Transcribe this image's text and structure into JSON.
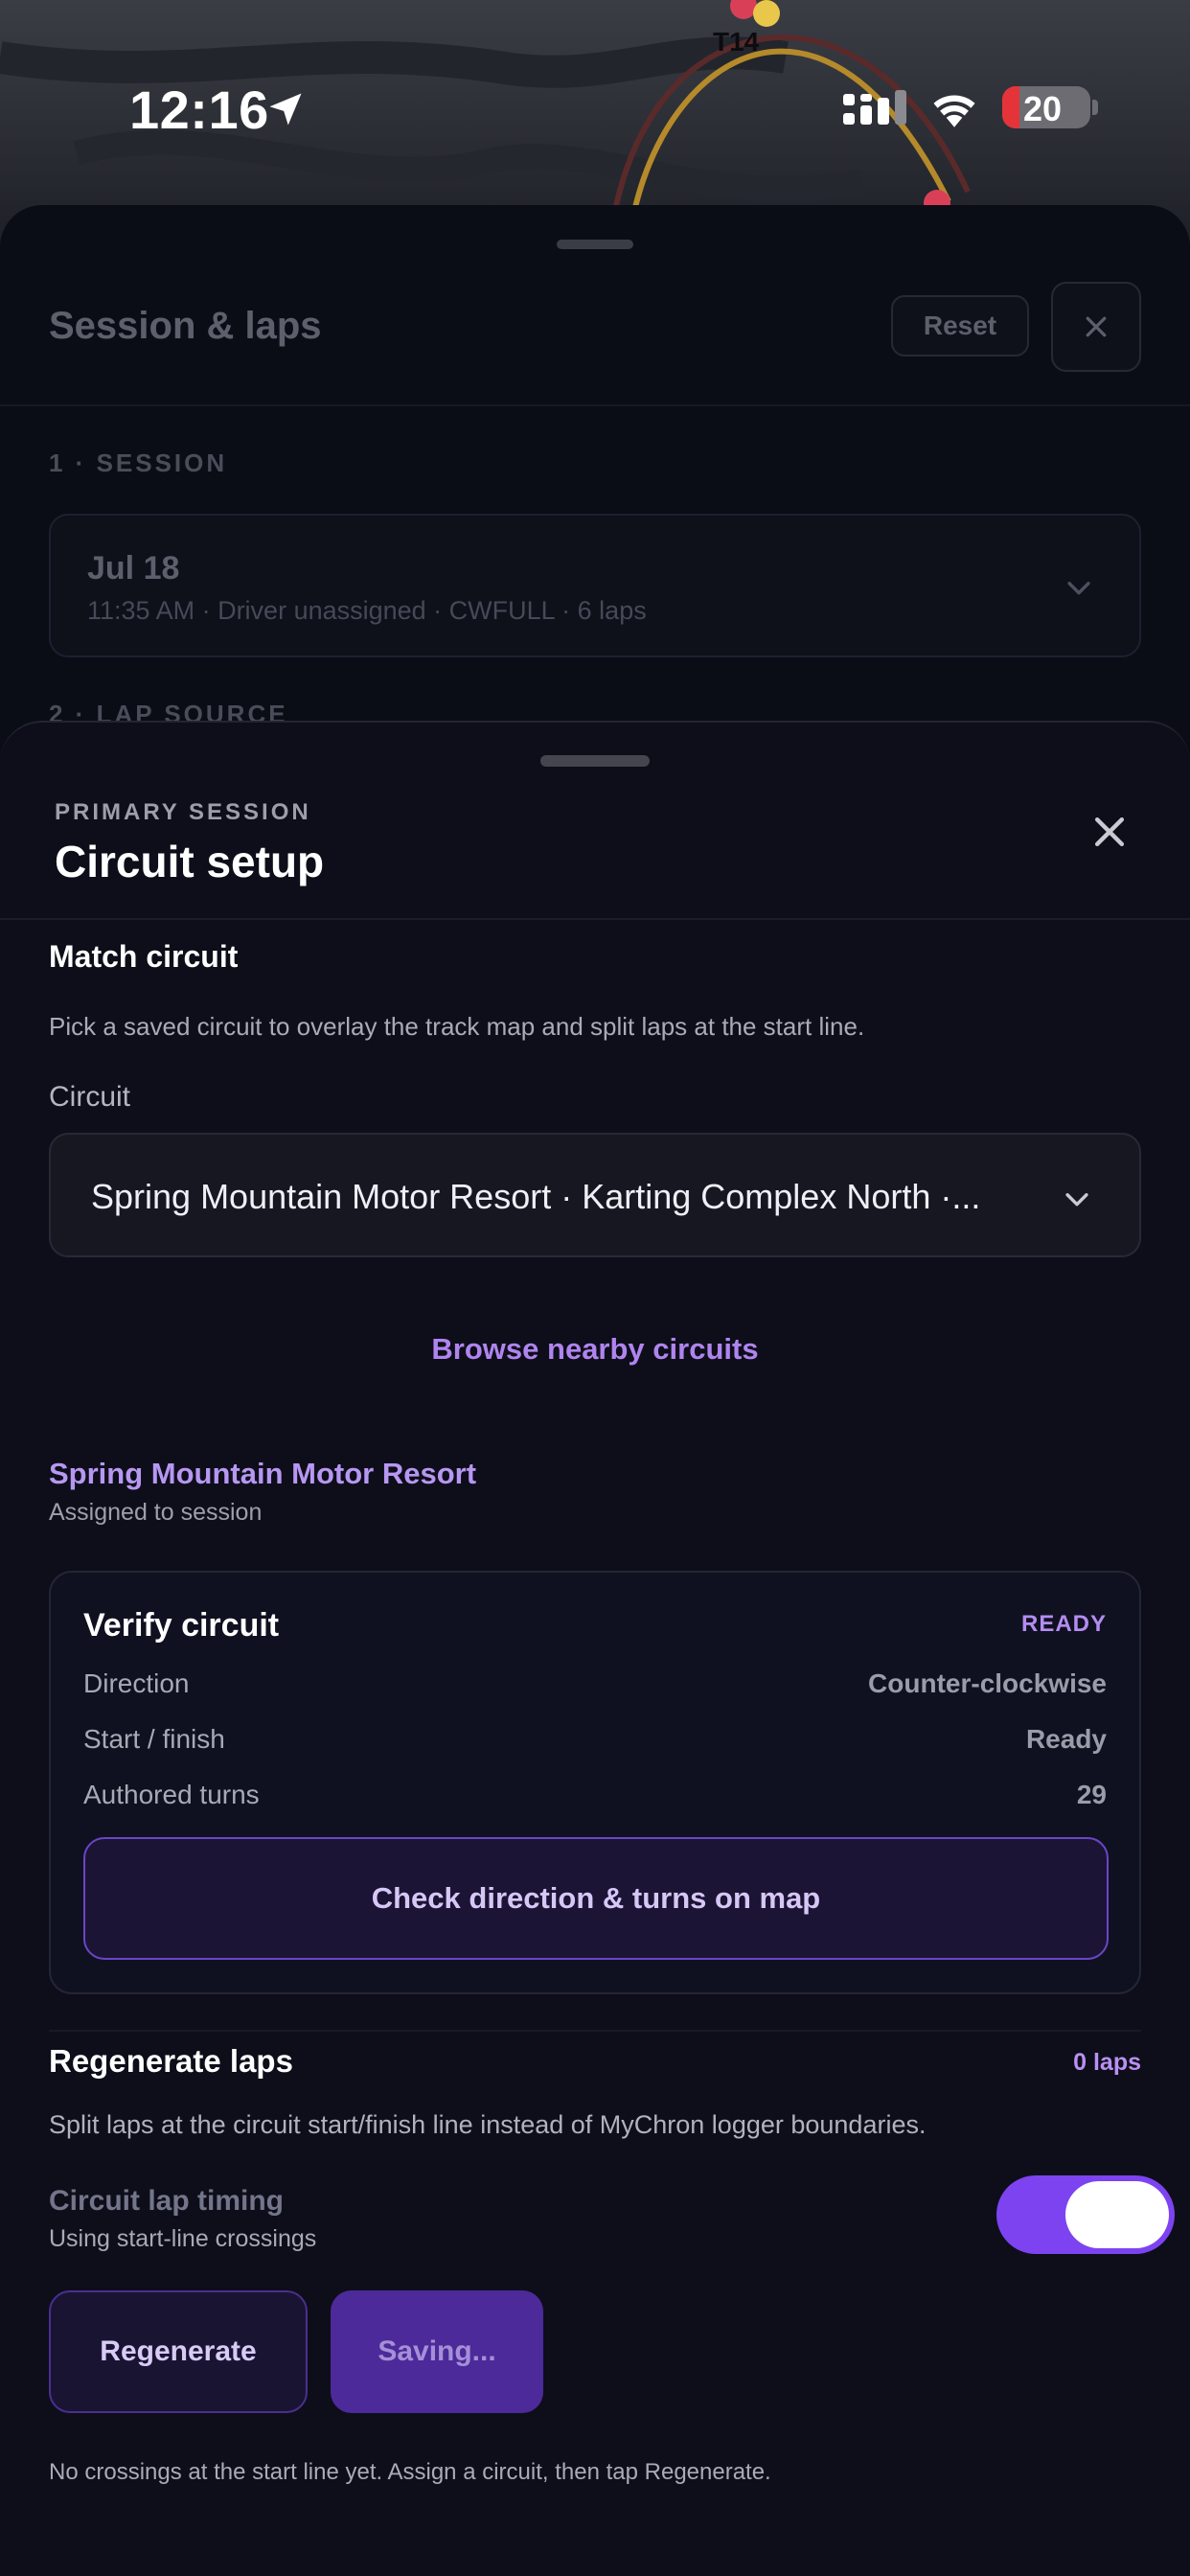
{
  "status_bar": {
    "time": "12:16",
    "battery_percent": "20",
    "battery_level": 0.2
  },
  "map": {
    "turn_label": "T14"
  },
  "back_sheet": {
    "title": "Session & laps",
    "reset_label": "Reset",
    "section_session": "1 · SESSION",
    "session_date": "Jul 18",
    "session_meta": "11:35 AM · Driver unassigned · CWFULL · 6 laps",
    "section_lap_source": "2 · LAP SOURCE"
  },
  "sheet": {
    "eyebrow": "PRIMARY SESSION",
    "title": "Circuit setup"
  },
  "match_circuit": {
    "heading": "Match circuit",
    "description": "Pick a saved circuit to overlay the track map and split laps at the start line.",
    "field_label": "Circuit",
    "selected_value": "Spring Mountain Motor Resort · Karting Complex North ·...",
    "browse_label": "Browse nearby circuits"
  },
  "assigned": {
    "name": "Spring Mountain Motor Resort",
    "subtitle": "Assigned to session"
  },
  "verify": {
    "title": "Verify circuit",
    "status": "READY",
    "rows": [
      {
        "key": "Direction",
        "value": "Counter-clockwise"
      },
      {
        "key": "Start / finish",
        "value": "Ready"
      },
      {
        "key": "Authored turns",
        "value": "29"
      }
    ],
    "map_button_label": "Check direction & turns on map"
  },
  "regenerate": {
    "heading": "Regenerate laps",
    "lap_count": "0 laps",
    "description": "Split laps at the circuit start/finish line instead of MyChron logger boundaries.",
    "timing_label": "Circuit lap timing",
    "timing_sub": "Using start-line crossings",
    "timing_enabled": true,
    "regenerate_label": "Regenerate",
    "saving_label": "Saving...",
    "note": "No crossings at the start line yet. Assign a circuit, then tap Regenerate."
  },
  "colors": {
    "accent": "#7d43f0",
    "accent_text": "#b084ef",
    "sheet_bg": "#0d0e19"
  }
}
